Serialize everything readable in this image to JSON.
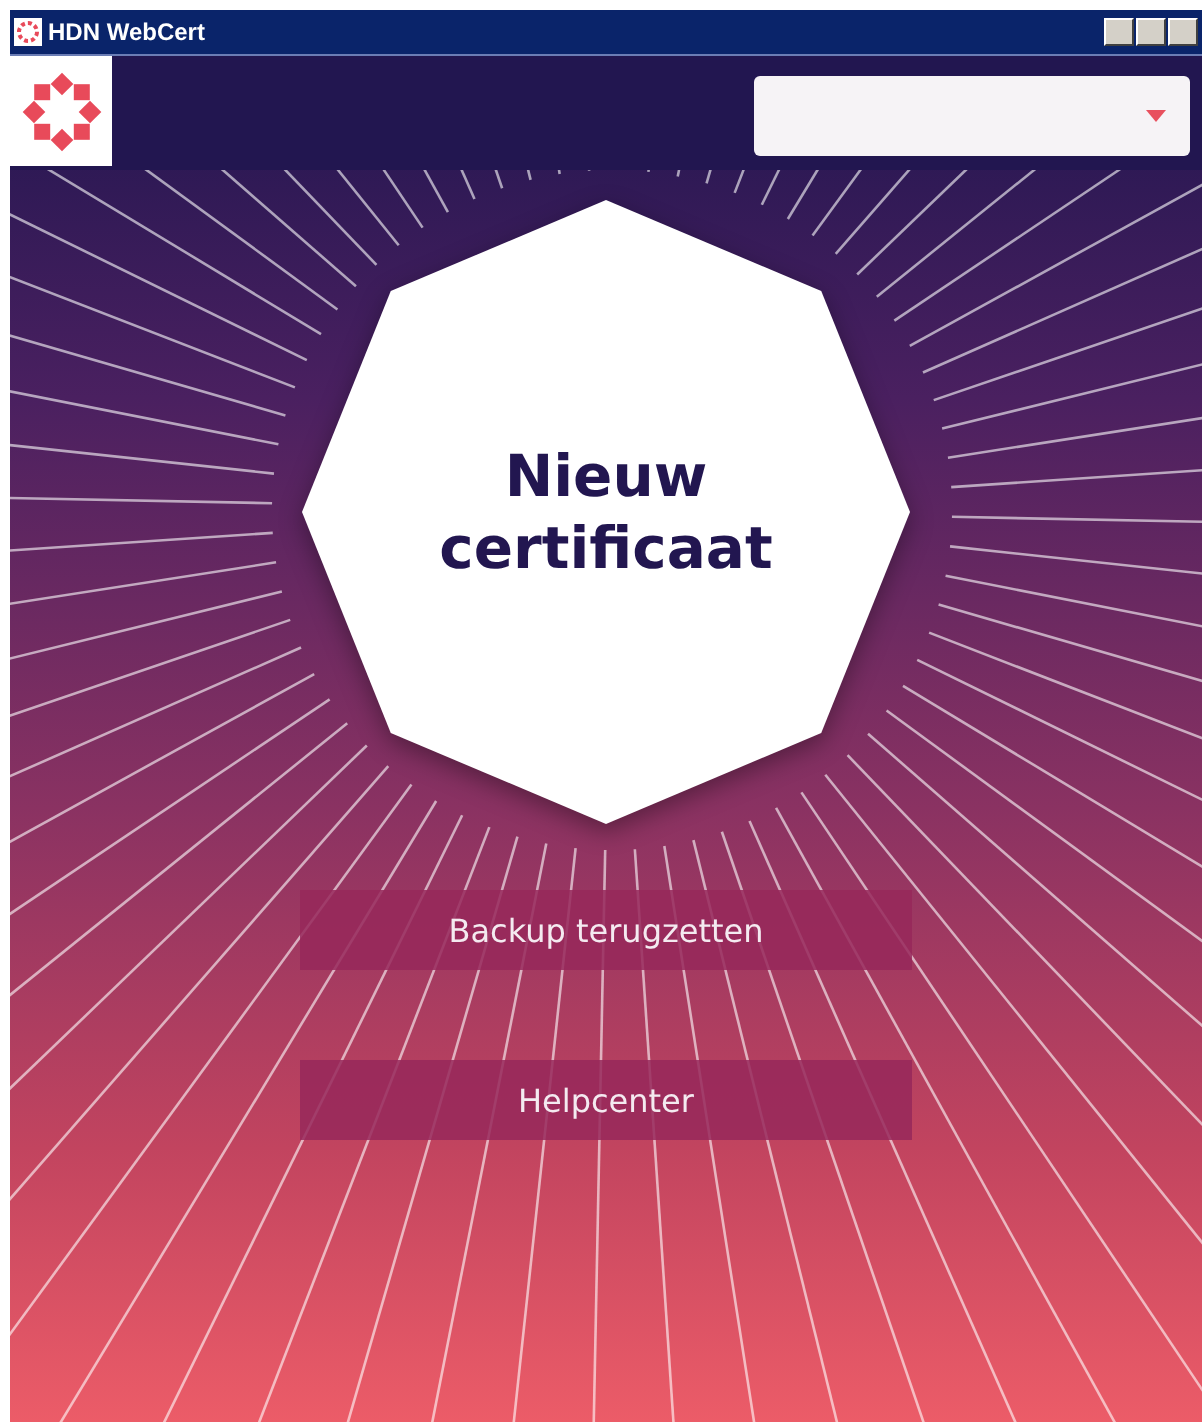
{
  "window": {
    "title": "HDN WebCert"
  },
  "hero": {
    "label": "Nieuw certificaat"
  },
  "buttons": [
    {
      "label": "Backup terugzetten"
    },
    {
      "label": "Helpcenter"
    }
  ]
}
